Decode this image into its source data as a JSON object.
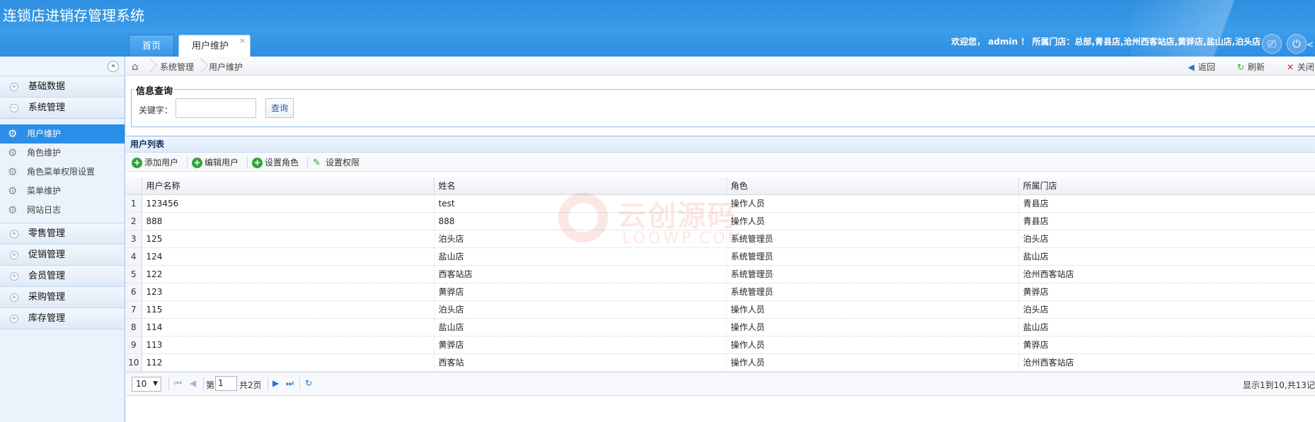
{
  "app": {
    "title": "连锁店进销存管理系统"
  },
  "top_tabs": [
    {
      "label": "首页"
    },
    {
      "label": "用户维护",
      "close": "×"
    }
  ],
  "header": {
    "welcome": "欢迎您， admin ！ 所属门店：总部,青县店,沧州西客站店,黄骅店,盐山店,泊头店",
    "clipboard_icon": "clipboard-icon",
    "power_icon": "power-icon",
    "more_label": "<"
  },
  "sidebar": {
    "collapse_label": "«",
    "groups_top": [
      {
        "label": "基础数据"
      },
      {
        "label": "系统管理"
      }
    ],
    "sub_items": [
      {
        "label": "用户维护"
      },
      {
        "label": "角色维护"
      },
      {
        "label": "角色菜单权限设置"
      },
      {
        "label": "菜单维护"
      },
      {
        "label": "网站日志"
      }
    ],
    "groups_bottom": [
      {
        "label": "零售管理"
      },
      {
        "label": "促销管理"
      },
      {
        "label": "会员管理"
      },
      {
        "label": "采购管理"
      },
      {
        "label": "库存管理"
      }
    ]
  },
  "breadcrumb": {
    "items": [
      "系统管理",
      "用户维护"
    ],
    "actions": {
      "back": "返回",
      "refresh": "刷新",
      "close": "关闭"
    }
  },
  "query": {
    "legend": "信息查询",
    "keyword_label": "关键字：",
    "keyword_value": "",
    "search_button": "查询"
  },
  "list": {
    "title": "用户列表",
    "toolbar": {
      "add_user": "添加用户",
      "edit_user": "编辑用户",
      "set_role": "设置角色",
      "set_permission": "设置权限"
    },
    "columns": [
      "用户名称",
      "姓名",
      "角色",
      "所属门店"
    ],
    "rows": [
      {
        "no": "1",
        "username": "123456",
        "name": "test",
        "role": "操作人员",
        "store": "青县店"
      },
      {
        "no": "2",
        "username": "888",
        "name": "888",
        "role": "操作人员",
        "store": "青县店"
      },
      {
        "no": "3",
        "username": "125",
        "name": "泊头店",
        "role": "系统管理员",
        "store": "泊头店"
      },
      {
        "no": "4",
        "username": "124",
        "name": "盐山店",
        "role": "系统管理员",
        "store": "盐山店"
      },
      {
        "no": "5",
        "username": "122",
        "name": "西客站店",
        "role": "系统管理员",
        "store": "沧州西客站店"
      },
      {
        "no": "6",
        "username": "123",
        "name": "黄骅店",
        "role": "系统管理员",
        "store": "黄骅店"
      },
      {
        "no": "7",
        "username": "115",
        "name": "泊头店",
        "role": "操作人员",
        "store": "泊头店"
      },
      {
        "no": "8",
        "username": "114",
        "name": "盐山店",
        "role": "操作人员",
        "store": "盐山店"
      },
      {
        "no": "9",
        "username": "113",
        "name": "黄骅店",
        "role": "操作人员",
        "store": "黄骅店"
      },
      {
        "no": "10",
        "username": "112",
        "name": "西客站",
        "role": "操作人员",
        "store": "沧州西客站店"
      }
    ]
  },
  "pager": {
    "page_size": "10",
    "page_prefix": "第",
    "page_value": "1",
    "page_suffix": "共2页",
    "info": "显示1到10,共13记"
  },
  "watermark": {
    "big": "云创源码",
    "small": "LOOWP.COM"
  },
  "colors": {
    "header": "#2e8fe0",
    "accent": "#2b8ee8",
    "border": "#95b8e7"
  }
}
